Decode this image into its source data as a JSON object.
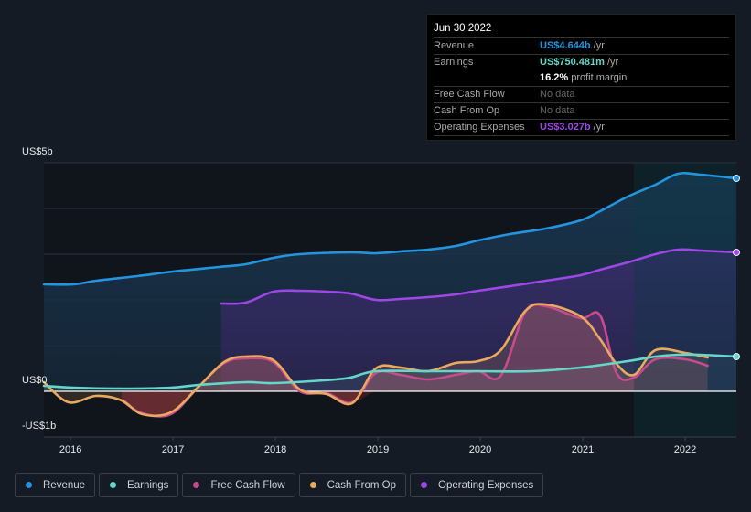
{
  "tooltip": {
    "date": "Jun 30 2022",
    "rows": [
      {
        "label": "Revenue",
        "value": "US$4.644b",
        "unit": "/yr",
        "color": "#2394df"
      },
      {
        "label": "Earnings",
        "value": "US$750.481m",
        "unit": "/yr",
        "color": "#65d6c9"
      },
      {
        "label": "",
        "value": "16.2%",
        "unit": "profit margin",
        "color": "#ffffff"
      },
      {
        "label": "Free Cash Flow",
        "value": "No data"
      },
      {
        "label": "Cash From Op",
        "value": "No data"
      },
      {
        "label": "Operating Expenses",
        "value": "US$3.027b",
        "unit": "/yr",
        "color": "#9d47e6"
      }
    ]
  },
  "legend": [
    {
      "label": "Revenue",
      "color": "#2394df"
    },
    {
      "label": "Earnings",
      "color": "#65d6c9"
    },
    {
      "label": "Free Cash Flow",
      "color": "#c84b8e"
    },
    {
      "label": "Cash From Op",
      "color": "#e9a95e"
    },
    {
      "label": "Operating Expenses",
      "color": "#9d47e6"
    }
  ],
  "chart_data": {
    "type": "area",
    "title": "",
    "xlabel": "",
    "ylabel": "",
    "ylim": [
      -1,
      5
    ],
    "xlim": [
      2015.74,
      2022.5
    ],
    "y_ticks": [
      {
        "value": 5,
        "label": "US$5b"
      },
      {
        "value": 0,
        "label": "US$0"
      },
      {
        "value": -1,
        "label": "-US$1b"
      }
    ],
    "x_ticks": [
      {
        "value": 2016,
        "label": "2016"
      },
      {
        "value": 2017,
        "label": "2017"
      },
      {
        "value": 2018,
        "label": "2018"
      },
      {
        "value": 2019,
        "label": "2019"
      },
      {
        "value": 2020,
        "label": "2020"
      },
      {
        "value": 2021,
        "label": "2021"
      },
      {
        "value": 2022,
        "label": "2022"
      }
    ],
    "grid": true,
    "highlight_from": 2021.5,
    "legend_position": "bottom",
    "series": [
      {
        "name": "Revenue",
        "color": "#2394df",
        "x": [
          2015.74,
          2016.03,
          2016.25,
          2016.65,
          2017.0,
          2017.45,
          2017.71,
          2017.98,
          2018.24,
          2018.73,
          2018.98,
          2019.22,
          2019.49,
          2019.76,
          2019.98,
          2020.29,
          2020.64,
          2020.98,
          2021.17,
          2021.44,
          2021.71,
          2021.93,
          2022.15,
          2022.5
        ],
        "values": [
          2.34,
          2.34,
          2.42,
          2.52,
          2.62,
          2.72,
          2.78,
          2.92,
          3.0,
          3.04,
          3.02,
          3.06,
          3.1,
          3.18,
          3.3,
          3.44,
          3.56,
          3.74,
          3.94,
          4.26,
          4.52,
          4.76,
          4.74,
          4.66
        ]
      },
      {
        "name": "Operating Expenses",
        "color": "#9d47e6",
        "x": [
          2017.47,
          2017.71,
          2017.98,
          2018.24,
          2018.5,
          2018.73,
          2018.98,
          2019.22,
          2019.49,
          2019.76,
          2019.98,
          2020.29,
          2020.64,
          2020.98,
          2021.17,
          2021.44,
          2021.71,
          2021.93,
          2022.15,
          2022.5
        ],
        "values": [
          1.92,
          1.94,
          2.18,
          2.2,
          2.18,
          2.14,
          2.0,
          2.02,
          2.06,
          2.12,
          2.2,
          2.3,
          2.42,
          2.54,
          2.66,
          2.82,
          3.0,
          3.1,
          3.08,
          3.04
        ]
      },
      {
        "name": "Earnings",
        "color": "#65d6c9",
        "x": [
          2015.74,
          2016.03,
          2016.5,
          2016.98,
          2017.25,
          2017.71,
          2017.98,
          2018.47,
          2018.73,
          2018.98,
          2019.49,
          2019.98,
          2020.5,
          2020.98,
          2021.44,
          2021.71,
          2021.93,
          2022.15,
          2022.5
        ],
        "values": [
          0.12,
          0.08,
          0.06,
          0.08,
          0.14,
          0.2,
          0.18,
          0.24,
          0.3,
          0.44,
          0.44,
          0.44,
          0.44,
          0.52,
          0.66,
          0.76,
          0.8,
          0.8,
          0.76
        ]
      },
      {
        "name": "Free Cash Flow",
        "color": "#c84b8e",
        "x": [
          2016.5,
          2016.7,
          2016.98,
          2017.25,
          2017.5,
          2017.71,
          2017.98,
          2018.24,
          2018.5,
          2018.75,
          2018.98,
          2019.22,
          2019.49,
          2019.76,
          2019.98,
          2020.2,
          2020.44,
          2020.64,
          2020.98,
          2021.17,
          2021.33,
          2021.5,
          2021.71,
          2022.0,
          2022.22
        ],
        "values": [
          -0.2,
          -0.48,
          -0.5,
          0.1,
          0.62,
          0.72,
          0.64,
          0.0,
          -0.04,
          -0.24,
          0.4,
          0.36,
          0.26,
          0.36,
          0.44,
          0.34,
          1.74,
          1.86,
          1.6,
          1.66,
          0.4,
          0.3,
          0.7,
          0.7,
          0.56
        ]
      },
      {
        "name": "Cash From Op",
        "color": "#e9a95e",
        "x": [
          2015.74,
          2015.98,
          2016.25,
          2016.5,
          2016.7,
          2016.98,
          2017.25,
          2017.5,
          2017.71,
          2017.98,
          2018.24,
          2018.5,
          2018.75,
          2018.98,
          2019.22,
          2019.49,
          2019.76,
          2019.98,
          2020.2,
          2020.44,
          2020.64,
          2020.98,
          2021.17,
          2021.33,
          2021.5,
          2021.71,
          2022.0,
          2022.22
        ],
        "values": [
          0.2,
          -0.24,
          -0.1,
          -0.2,
          -0.5,
          -0.46,
          0.1,
          0.64,
          0.76,
          0.68,
          0.04,
          -0.06,
          -0.26,
          0.5,
          0.52,
          0.44,
          0.62,
          0.66,
          0.9,
          1.76,
          1.9,
          1.64,
          1.14,
          0.6,
          0.36,
          0.9,
          0.84,
          0.74
        ]
      }
    ]
  }
}
